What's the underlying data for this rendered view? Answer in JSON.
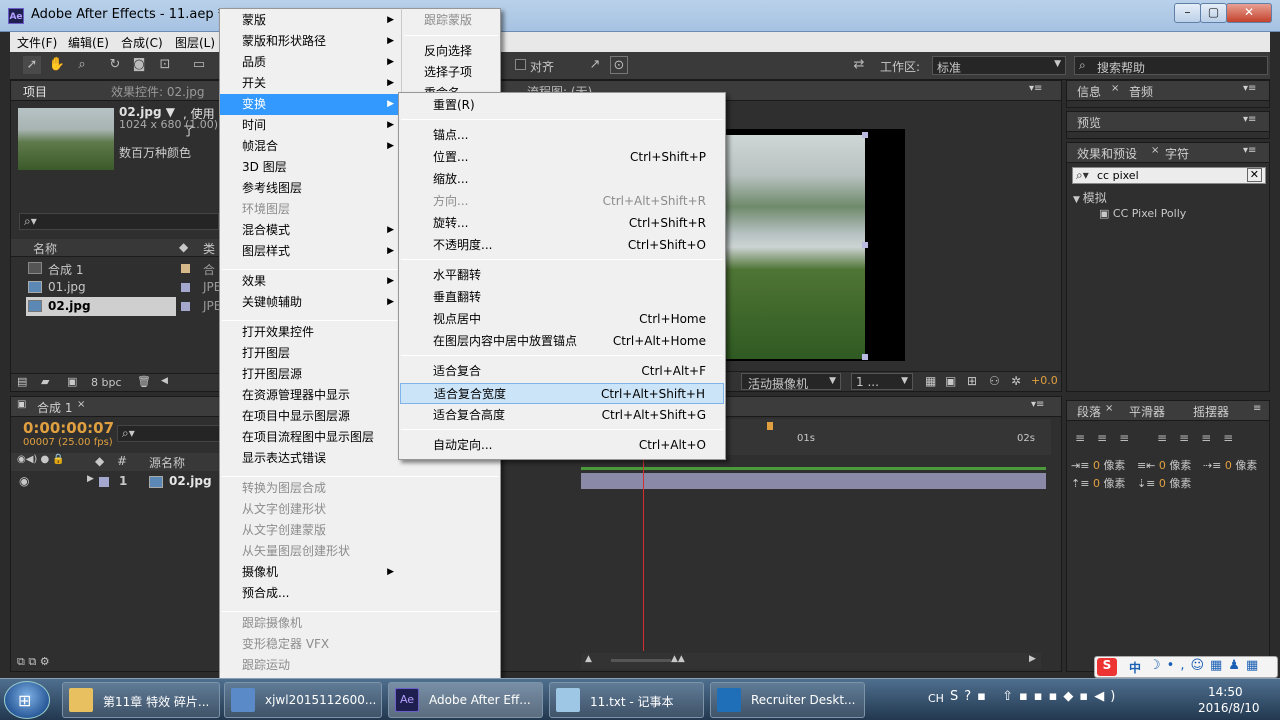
{
  "window": {
    "title": "Adobe After Effects - 11.aep *",
    "logo": "Ae"
  },
  "menubar": [
    "文件(F)",
    "编辑(E)",
    "合成(C)",
    "图层(L)"
  ],
  "toolbar": {
    "align_label": "对齐",
    "workspace_label": "工作区:",
    "workspace_value": "标准",
    "search_help_placeholder": "搜索帮助"
  },
  "project_panel": {
    "tab": "项目",
    "tab2": "效果控件: 02.jpg",
    "item_name": "02.jpg ▼",
    "item_used": ", 使用了",
    "item_dims": "1024 x 680 (1.00)",
    "item_colors": "数百万种颜色",
    "col_name": "名称",
    "col_type": "类",
    "rows": [
      {
        "name": "合成 1",
        "type": "合"
      },
      {
        "name": "01.jpg",
        "type": "JPE"
      },
      {
        "name": "02.jpg",
        "type": "JPE"
      }
    ],
    "bpc": "8 bpc"
  },
  "layer_menu": {
    "items": [
      {
        "label": "蒙版",
        "sub": true,
        "dis": false
      },
      {
        "label": "蒙版和形状路径",
        "sub": true,
        "dis": false
      },
      {
        "label": "品质",
        "sub": true,
        "dis": false
      },
      {
        "label": "开关",
        "sub": true,
        "dis": false
      },
      {
        "label": "变换",
        "sub": true,
        "dis": false,
        "hl": true
      },
      {
        "label": "时间",
        "sub": true,
        "dis": false
      },
      {
        "label": "帧混合",
        "sub": true,
        "dis": false
      },
      {
        "label": "3D 图层",
        "sub": false,
        "dis": false
      },
      {
        "label": "参考线图层",
        "sub": false,
        "dis": false
      },
      {
        "label": "环境图层",
        "sub": false,
        "dis": true
      },
      {
        "label": "混合模式",
        "sub": true,
        "dis": false
      },
      {
        "label": "图层样式",
        "sub": true,
        "dis": false
      },
      {
        "sep": true
      },
      {
        "label": "效果",
        "sub": true,
        "dis": false
      },
      {
        "label": "关键帧辅助",
        "sub": true,
        "dis": false
      },
      {
        "sep": true
      },
      {
        "label": "打开效果控件",
        "sub": false,
        "dis": false
      },
      {
        "label": "打开图层",
        "sub": false,
        "dis": false
      },
      {
        "label": "打开图层源",
        "sub": false,
        "dis": false
      },
      {
        "label": "在资源管理器中显示",
        "sub": false,
        "dis": false
      },
      {
        "label": "在项目中显示图层源",
        "sub": false,
        "dis": false
      },
      {
        "label": "在项目流程图中显示图层",
        "sub": false,
        "dis": false
      },
      {
        "label": "显示表达式错误",
        "sub": false,
        "dis": false
      },
      {
        "sep": true
      },
      {
        "label": "转换为图层合成",
        "sub": false,
        "dis": true
      },
      {
        "label": "从文字创建形状",
        "sub": false,
        "dis": true
      },
      {
        "label": "从文字创建蒙版",
        "sub": false,
        "dis": true
      },
      {
        "label": "从矢量图层创建形状",
        "sub": false,
        "dis": true
      },
      {
        "label": "摄像机",
        "sub": true,
        "dis": false
      },
      {
        "label": "预合成...",
        "sub": false,
        "dis": false
      },
      {
        "sep": true
      },
      {
        "label": "跟踪摄像机",
        "sub": false,
        "dis": true
      },
      {
        "label": "变形稳定器 VFX",
        "sub": false,
        "dis": true
      },
      {
        "label": "跟踪运动",
        "sub": false,
        "dis": true
      }
    ]
  },
  "mask_menu": {
    "items": [
      {
        "label": "跟踪蒙版",
        "dis": true
      },
      {
        "sep": true
      },
      {
        "label": "反向选择",
        "dis": false
      },
      {
        "label": "选择子项",
        "dis": false
      },
      {
        "label": "重命名",
        "dis": false
      }
    ]
  },
  "transform_menu": {
    "items": [
      {
        "label": "重置(R)",
        "shortcut": "",
        "dis": false
      },
      {
        "sep": true
      },
      {
        "label": "锚点...",
        "shortcut": "",
        "dis": false
      },
      {
        "label": "位置...",
        "shortcut": "Ctrl+Shift+P",
        "dis": false
      },
      {
        "label": "缩放...",
        "shortcut": "",
        "dis": false
      },
      {
        "label": "方向...",
        "shortcut": "Ctrl+Alt+Shift+R",
        "dis": true
      },
      {
        "label": "旋转...",
        "shortcut": "Ctrl+Shift+R",
        "dis": false
      },
      {
        "label": "不透明度...",
        "shortcut": "Ctrl+Shift+O",
        "dis": false
      },
      {
        "sep": true
      },
      {
        "label": "水平翻转",
        "shortcut": "",
        "dis": false
      },
      {
        "label": "垂直翻转",
        "shortcut": "",
        "dis": false
      },
      {
        "label": "视点居中",
        "shortcut": "Ctrl+Home",
        "dis": false
      },
      {
        "label": "在图层内容中居中放置锚点",
        "shortcut": "Ctrl+Alt+Home",
        "dis": false
      },
      {
        "sep": true
      },
      {
        "label": "适合复合",
        "shortcut": "Ctrl+Alt+F",
        "dis": false
      },
      {
        "label": "适合复合宽度",
        "shortcut": "Ctrl+Alt+Shift+H",
        "dis": false,
        "hover": true
      },
      {
        "label": "适合复合高度",
        "shortcut": "Ctrl+Alt+Shift+G",
        "dis": false
      },
      {
        "sep": true
      },
      {
        "label": "自动定向...",
        "shortcut": "Ctrl+Alt+O",
        "dis": false
      }
    ]
  },
  "viewer": {
    "flow_tab": "流程图: (无)",
    "camera": "活动摄像机",
    "views": "1 ...",
    "exposure": "+0.0"
  },
  "right_panels": {
    "info": "信息",
    "audio": "音频",
    "preview": "预览",
    "effects": "效果和预设",
    "character": "字符",
    "search_value": "cc pixel",
    "category": "模拟",
    "effect": "CC Pixel Polly",
    "paragraph": "段落",
    "smoother": "平滑器",
    "wiggler": "摇摆器",
    "px_value": "0",
    "px_unit": "像素"
  },
  "timeline": {
    "tab": "合成 1",
    "timecode": "0:00:00:07",
    "frames": "00007 (25.00 fps)",
    "col_source": "源名称",
    "col_num": "#",
    "layer_num": "1",
    "layer_name": "02.jpg",
    "ruler": [
      "01s",
      "02s"
    ]
  },
  "taskbar": {
    "tasks": [
      "第11章 特效 碎片...",
      "xjwl2015112600...",
      "Adobe After Eff...",
      "11.txt - 记事本",
      "Recruiter Deskt..."
    ],
    "lang": "CH",
    "time": "14:50",
    "date": "2016/8/10",
    "ime": "中"
  }
}
